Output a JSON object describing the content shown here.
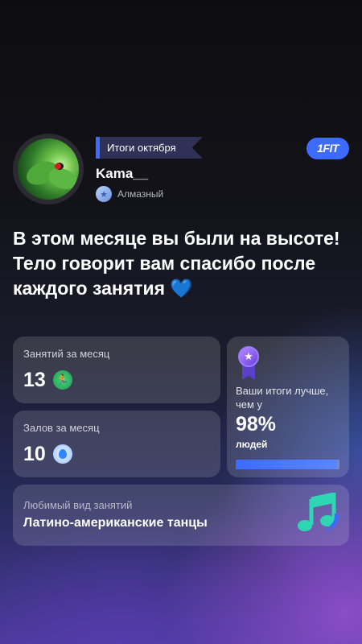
{
  "header": {
    "period_tag": "Итоги октября",
    "brand_logo": "1FIT",
    "username": "Kama__",
    "rank": "Алмазный",
    "rank_icon": "star-badge-icon"
  },
  "headline": {
    "text": "В этом месяце вы были на высоте! Тело говорит вам спасибо после каждого занятия",
    "emoji": "💙"
  },
  "stats": {
    "workouts": {
      "label": "Занятий за месяц",
      "value": "13",
      "icon": "runner-icon"
    },
    "gyms": {
      "label": "Залов за месяц",
      "value": "10",
      "icon": "location-pin-icon"
    },
    "ranking": {
      "label": "Ваши итоги лучше, чем у",
      "percent": "98%",
      "suffix": "людей",
      "progress": 0.98,
      "icon": "medal-icon"
    }
  },
  "favorite": {
    "label": "Любимый вид занятий",
    "value": "Латино-американские танцы",
    "icon": "music-note-icon"
  },
  "colors": {
    "accent": "#3d6bff",
    "card_bg": "rgba(255,255,255,0.14)"
  }
}
